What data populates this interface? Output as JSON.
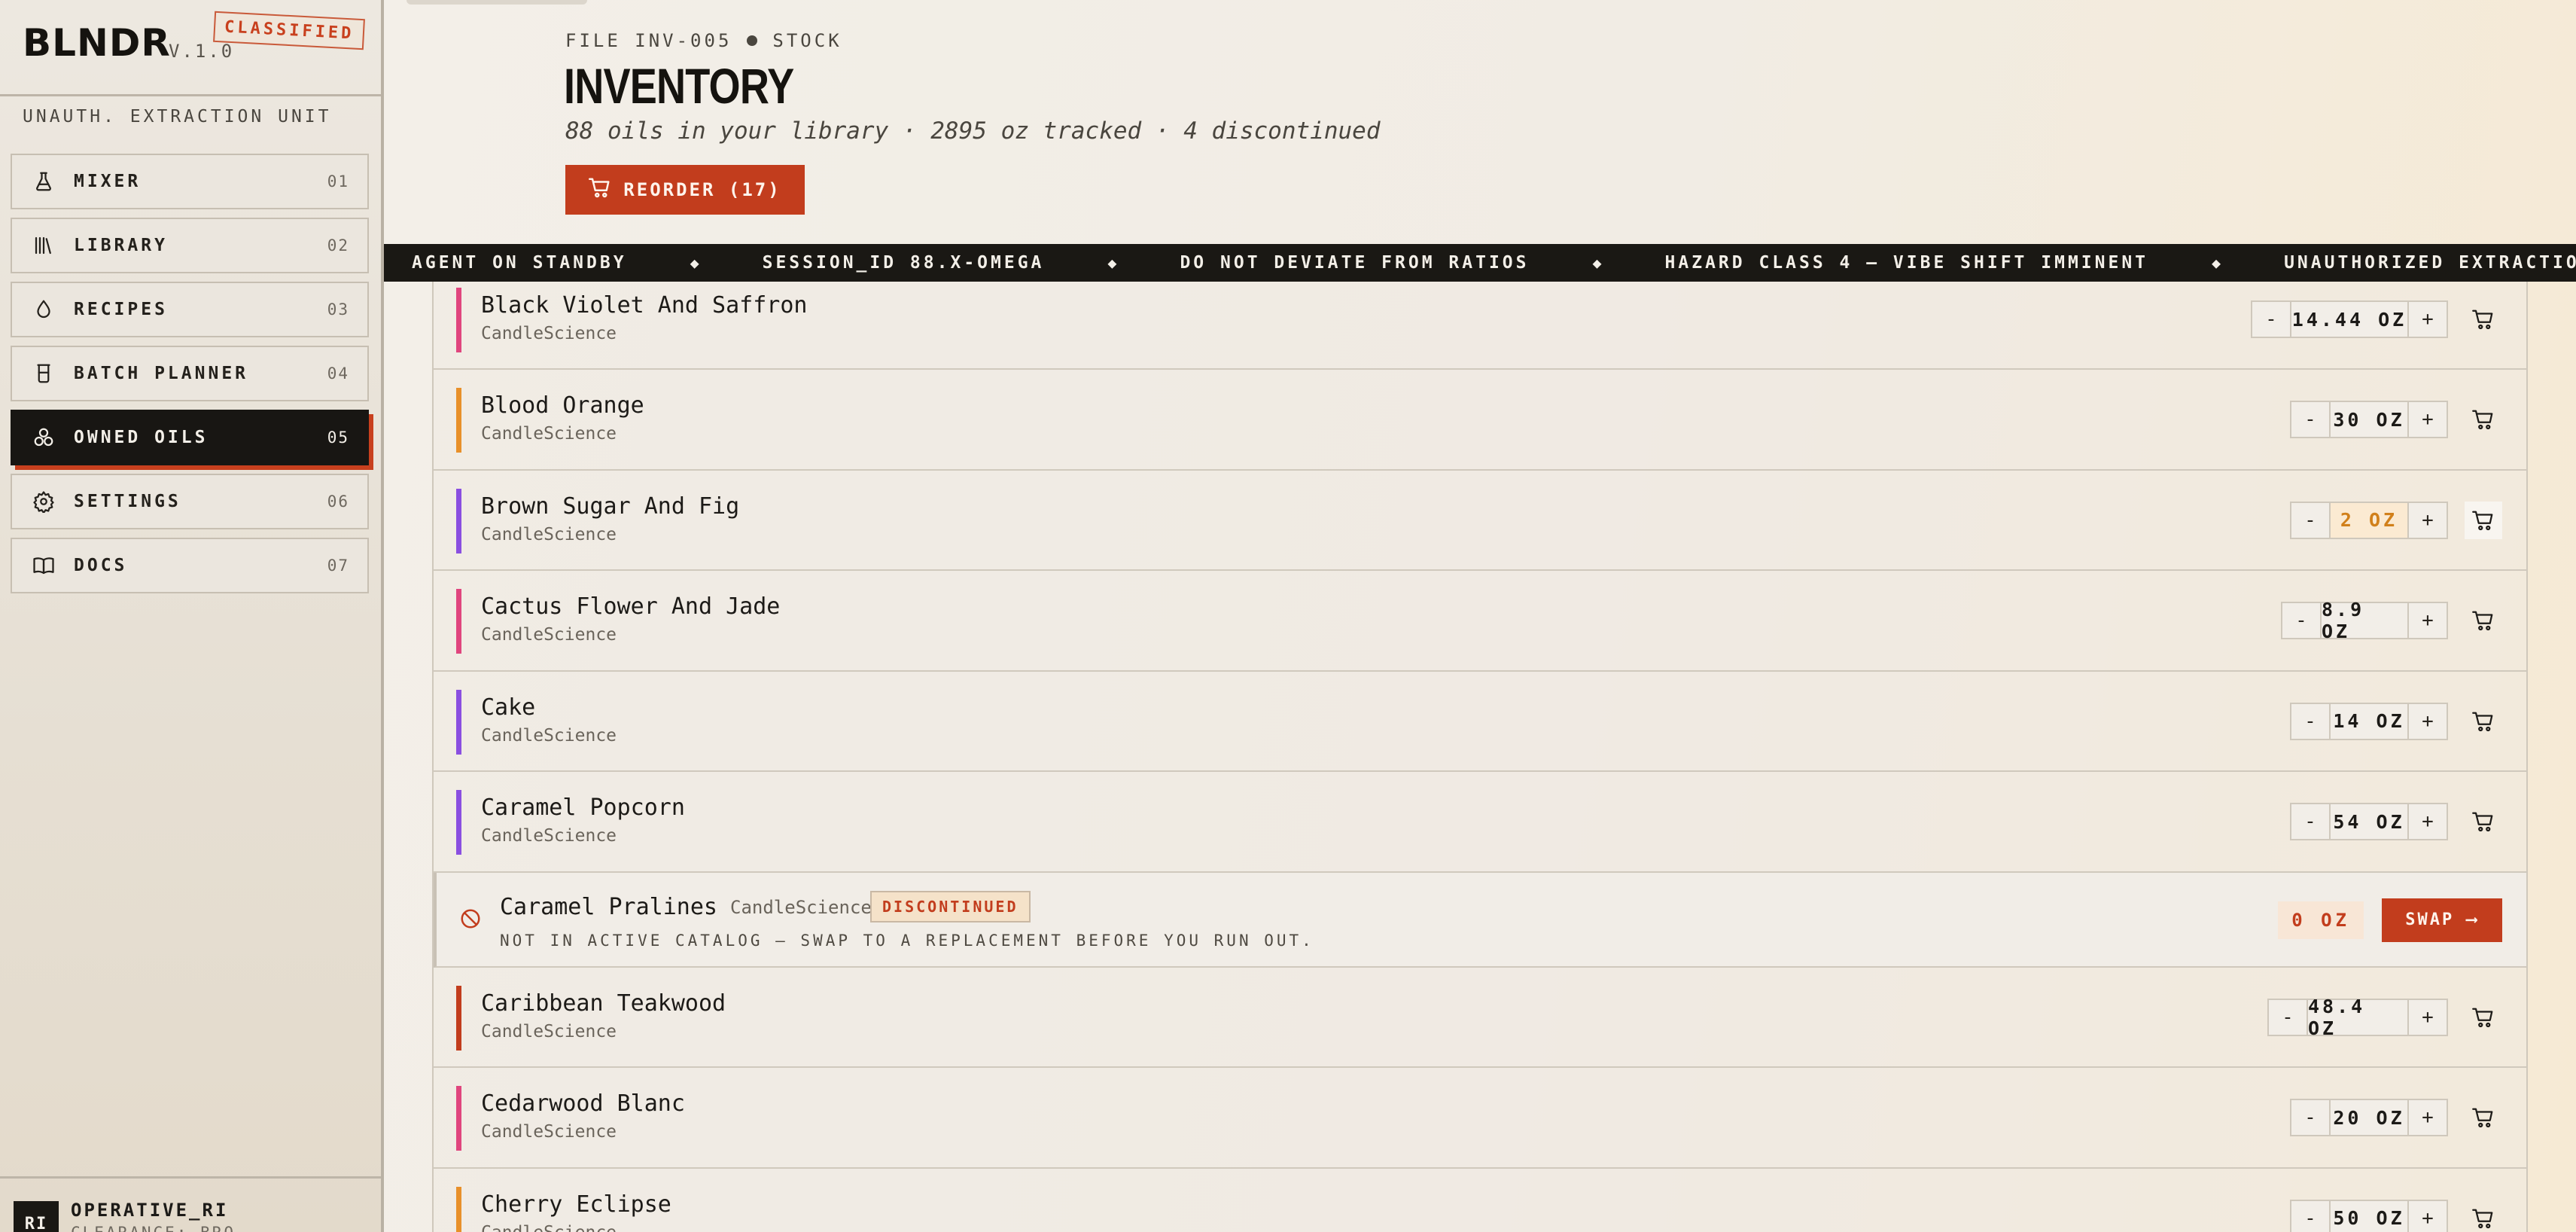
{
  "app": {
    "brand": "BLNDR",
    "version": "V.1.0",
    "stamp": "CLASSIFIED",
    "unit_label": "UNAUTH. EXTRACTION UNIT"
  },
  "nav": [
    {
      "label": "MIXER",
      "num": "01",
      "icon": "flask-icon"
    },
    {
      "label": "LIBRARY",
      "num": "02",
      "icon": "library-icon"
    },
    {
      "label": "RECIPES",
      "num": "03",
      "icon": "drop-icon"
    },
    {
      "label": "BATCH PLANNER",
      "num": "04",
      "icon": "beaker-icon"
    },
    {
      "label": "OWNED OILS",
      "num": "05",
      "icon": "circles-icon",
      "active": true
    },
    {
      "label": "SETTINGS",
      "num": "06",
      "icon": "gear-icon"
    },
    {
      "label": "DOCS",
      "num": "07",
      "icon": "book-icon"
    }
  ],
  "user": {
    "initials": "RI",
    "name": "OPERATIVE_RI",
    "clearance": "CLEARANCE: BRO"
  },
  "header": {
    "file_id": "FILE INV-005",
    "section": "STOCK",
    "title": "INVENTORY",
    "subtitle": "88 oils in your library · 2895 oz tracked · 4 discontinued",
    "reorder_label": "REORDER (17)"
  },
  "ticker": [
    "AGENT ON STANDBY",
    "SESSION_ID 88.X-OMEGA",
    "DO NOT DEVIATE FROM RATIOS",
    "HAZARD CLASS 4 — VIBE SHIFT IMMINENT",
    "UNAUTHORIZED EXTRACTION UNIT"
  ],
  "ticker_separator": "◆",
  "oils": [
    {
      "name": "Black Violet And Saffron",
      "brand": "CandleScience",
      "qty": "14.44 OZ",
      "color": "#e0457e"
    },
    {
      "name": "Blood Orange",
      "brand": "CandleScience",
      "qty": "30 OZ",
      "color": "#e8902a"
    },
    {
      "name": "Brown Sugar And Fig",
      "brand": "CandleScience",
      "qty": "2 OZ",
      "color": "#8a4fe0",
      "low": true
    },
    {
      "name": "Cactus Flower And Jade",
      "brand": "CandleScience",
      "qty": "8.9 OZ",
      "color": "#e0457e"
    },
    {
      "name": "Cake",
      "brand": "CandleScience",
      "qty": "14 OZ",
      "color": "#8a4fe0"
    },
    {
      "name": "Caramel Popcorn",
      "brand": "CandleScience",
      "qty": "54 OZ",
      "color": "#8a4fe0"
    },
    {
      "name": "Caramel Pralines",
      "brand": "CandleScience",
      "discontinued": true,
      "badge": "DISCONTINUED",
      "note": "NOT IN ACTIVE CATALOG — SWAP TO A REPLACEMENT BEFORE YOU RUN OUT.",
      "qty": "0 OZ",
      "swap_label": "SWAP ⟶"
    },
    {
      "name": "Caribbean Teakwood",
      "brand": "CandleScience",
      "qty": "48.4 OZ",
      "color": "#c23d1d"
    },
    {
      "name": "Cedarwood Blanc",
      "brand": "CandleScience",
      "qty": "20 OZ",
      "color": "#e0457e"
    },
    {
      "name": "Cherry Eclipse",
      "brand": "CandleScience",
      "qty": "50 OZ",
      "color": "#e8902a"
    }
  ],
  "stepper": {
    "minus": "-",
    "plus": "+"
  }
}
